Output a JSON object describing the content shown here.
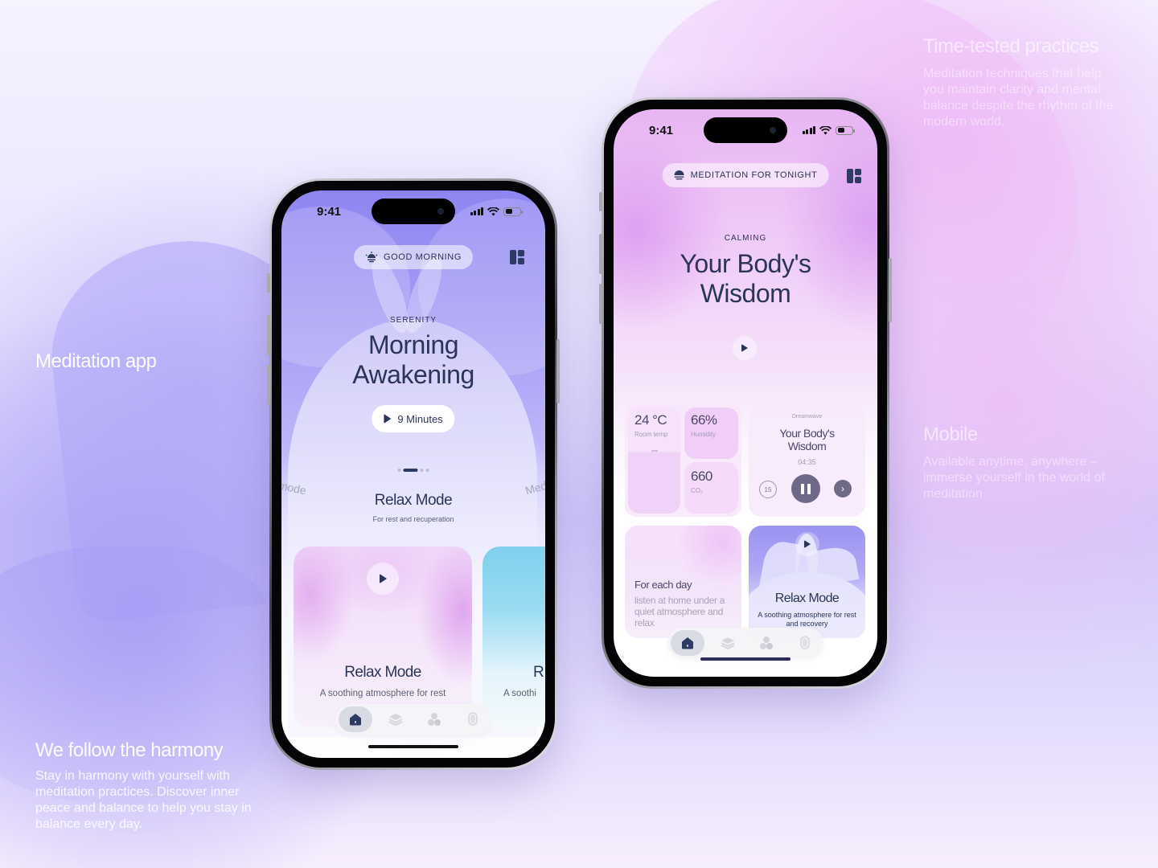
{
  "colors": {
    "primary_text": "#2a3558",
    "accent_navy": "#2d3a64",
    "player_accent": "#6e6987",
    "bg_lavender": "#cfc8fb",
    "bg_pink": "#ecb4f5"
  },
  "side_texts": {
    "meditation_app": {
      "title": "Meditation app"
    },
    "harmony": {
      "title": "We follow the harmony",
      "body": "Stay in harmony with yourself with meditation practices. Discover inner peace and balance to help you stay in balance every day."
    },
    "time_tested": {
      "title": "Time-tested practices",
      "body": "Meditation techniques that help you maintain clarity and mental balance despite the rhythm of the modern world."
    },
    "mobile": {
      "title": "Mobile",
      "body": "Available anytime, anywhere – immerse yourself in the world of meditation."
    }
  },
  "phone1": {
    "status_time": "9:41",
    "greeting_icon": "sunrise-icon",
    "greeting": "GOOD MORNING",
    "menu_icon": "grid-menu-icon",
    "eyebrow": "SERENITY",
    "title_line1": "Morning",
    "title_line2": "Awakening",
    "duration_button": "9 Minutes",
    "carousel": {
      "total": 4,
      "active_index": 1
    },
    "curve_left": "mode",
    "curve_right": "Med",
    "section_title": "Relax Mode",
    "section_subtitle": "For rest and recuperation",
    "cards": [
      {
        "title": "Relax Mode",
        "subtitle": "A soothing atmosphere for rest",
        "theme": "pink"
      },
      {
        "title": "R",
        "subtitle": "A soothi",
        "theme": "blue"
      }
    ],
    "tabs": [
      {
        "icon": "home-icon",
        "active": true
      },
      {
        "icon": "layers-icon",
        "active": false
      },
      {
        "icon": "community-icon",
        "active": false
      },
      {
        "icon": "microphone-icon",
        "active": false
      }
    ]
  },
  "phone2": {
    "status_time": "9:41",
    "chip_icon": "moon-sunset-icon",
    "chip_label": "MEDITATION FOR TONIGHT",
    "menu_icon": "grid-menu-icon",
    "eyebrow": "CALMING",
    "title_line1": "Your Body's",
    "title_line2": "Wisdom",
    "sensors": {
      "room_temp": {
        "value": "24 °C",
        "label": "Room temp"
      },
      "humidity": {
        "value": "66%",
        "label": "Humidity"
      },
      "co2": {
        "value": "660",
        "label": "CO₂"
      }
    },
    "player": {
      "brand": "Dreamwave",
      "title_line1": "Your Body's",
      "title_line2": "Wisdom",
      "time": "04:35",
      "rewind_label": "15"
    },
    "day_card": {
      "title": "For each day",
      "body": "listen at home under a quiet atmosphere and relax"
    },
    "relax_card": {
      "title": "Relax Mode",
      "subtitle": "A soothing atmosphere for rest and recovery"
    },
    "tabs": [
      {
        "icon": "home-icon",
        "active": true
      },
      {
        "icon": "layers-icon",
        "active": false
      },
      {
        "icon": "community-icon",
        "active": false
      },
      {
        "icon": "microphone-icon",
        "active": false
      }
    ]
  }
}
